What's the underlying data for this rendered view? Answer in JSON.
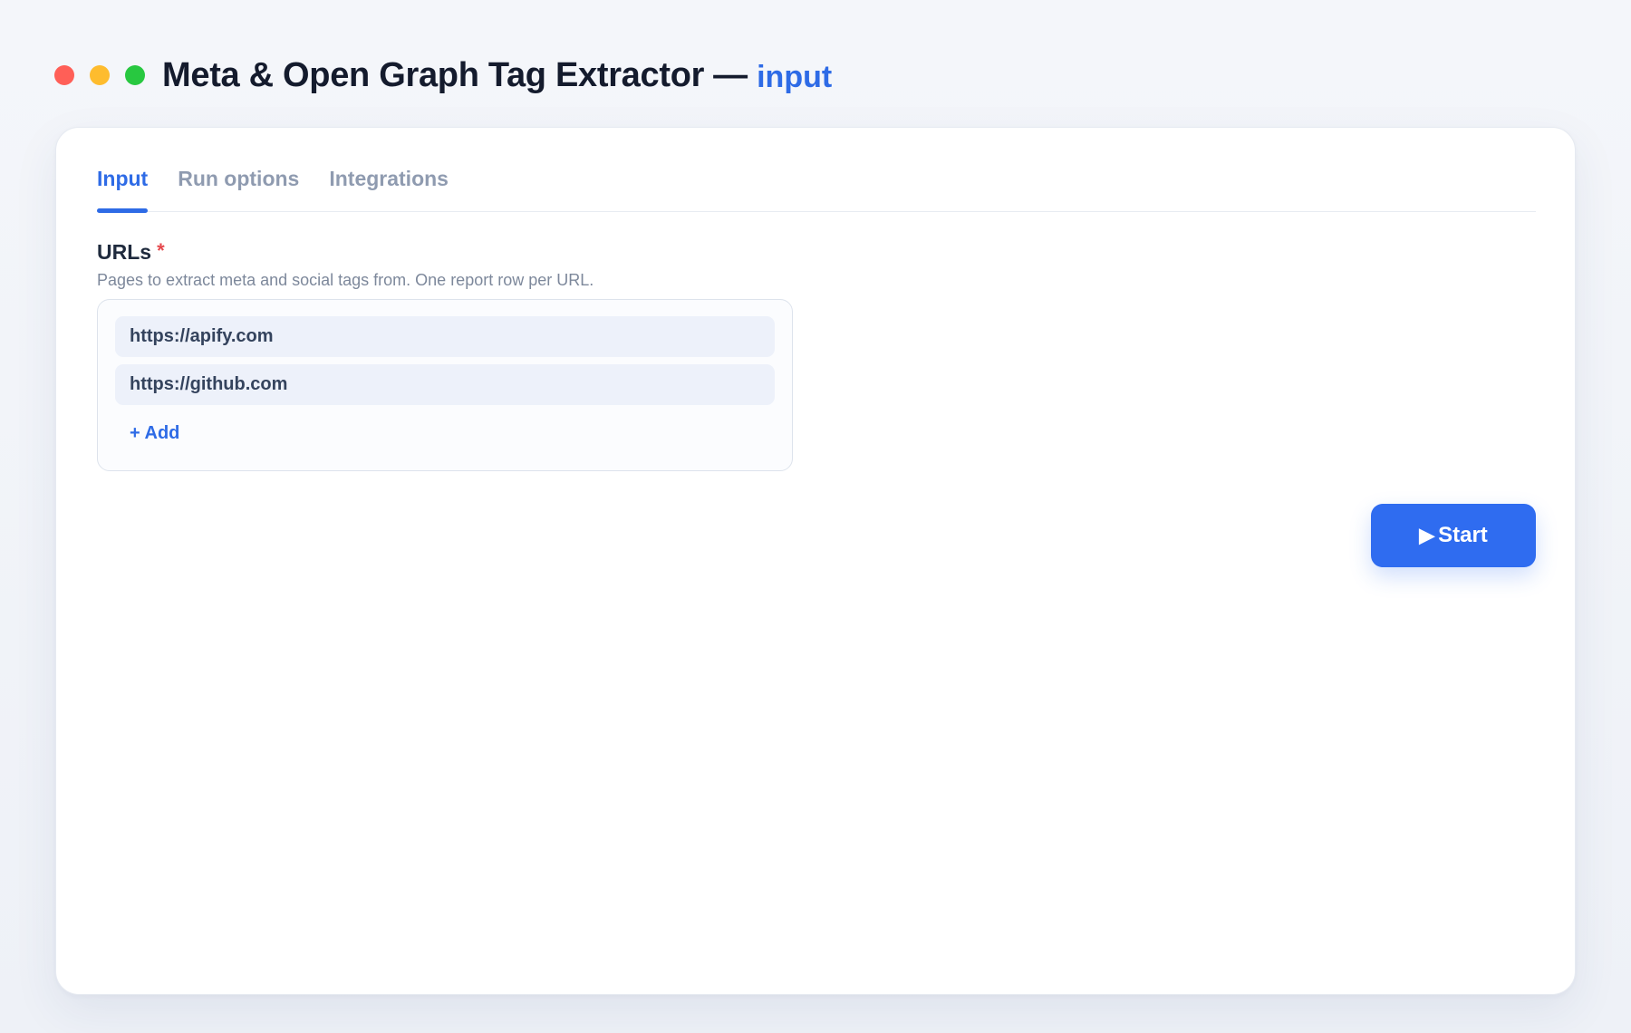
{
  "window": {
    "title": "Meta & Open Graph Tag Extractor",
    "title_separator": "—",
    "subtitle": "input"
  },
  "tabs": [
    {
      "label": "Input",
      "active": true
    },
    {
      "label": "Run options",
      "active": false
    },
    {
      "label": "Integrations",
      "active": false
    }
  ],
  "field": {
    "label": "URLs",
    "required_marker": "*",
    "description": "Pages to extract meta and social tags from. One report row per URL.",
    "values": [
      "https://apify.com",
      "https://github.com"
    ],
    "add_label": "+ Add"
  },
  "actions": {
    "start_icon": "▶",
    "start_label": "Start"
  },
  "colors": {
    "accent": "#2e6be6",
    "start_button": "#2f6cf0",
    "required": "#e5484d",
    "traffic_red": "#ff5f57",
    "traffic_yellow": "#febc2e",
    "traffic_green": "#28c840"
  }
}
